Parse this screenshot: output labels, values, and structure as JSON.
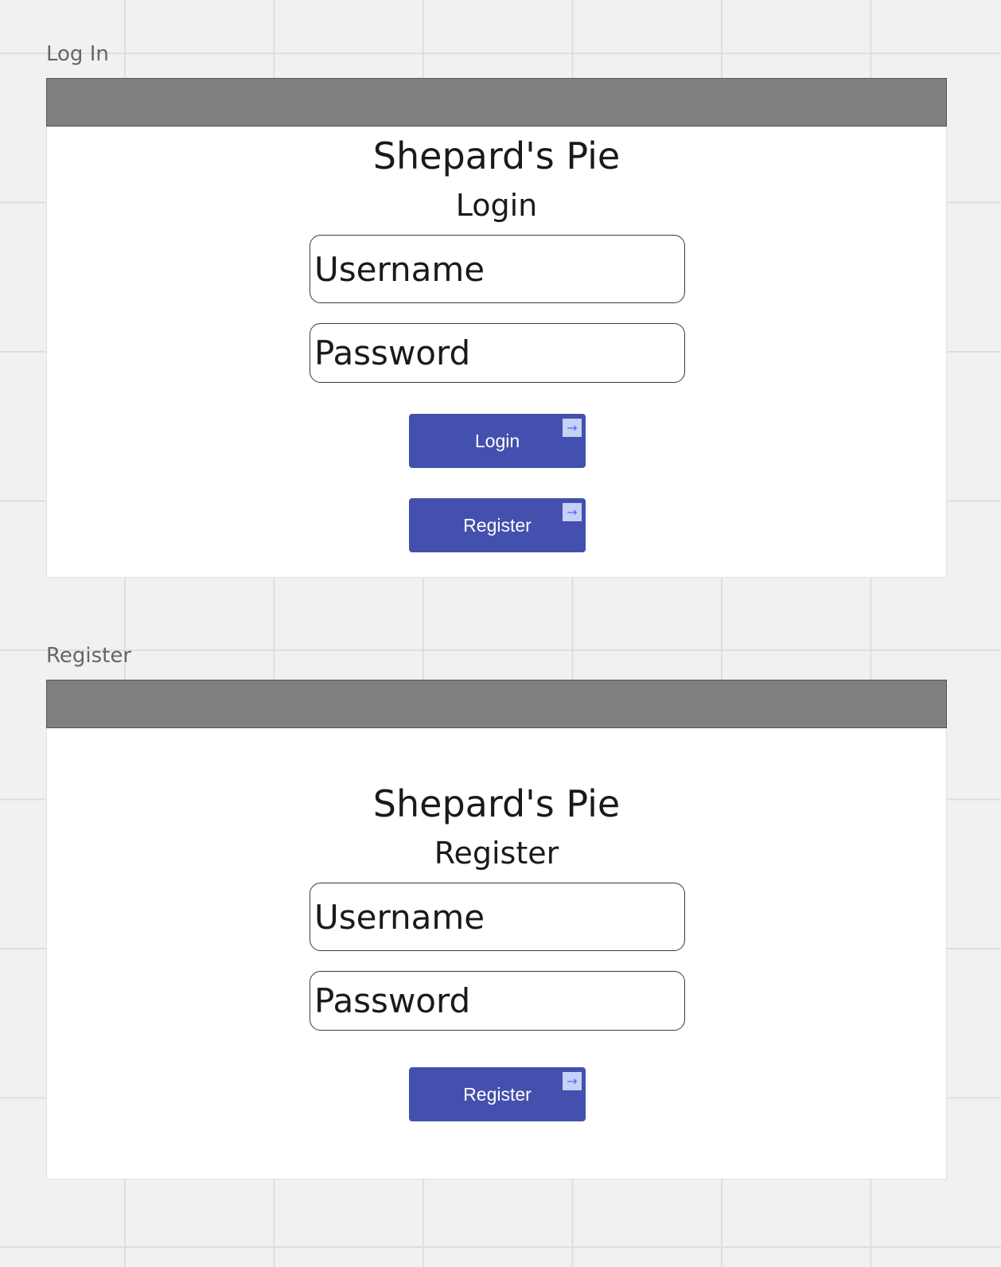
{
  "login_frame": {
    "label": "Log In",
    "app_title": "Shepard's Pie",
    "form_title": "Login",
    "username_placeholder": "Username",
    "password_placeholder": "Password",
    "login_button": "Login",
    "register_button": "Register",
    "button_icon": "arrow-right-icon"
  },
  "register_frame": {
    "label": "Register",
    "app_title": "Shepard's Pie",
    "form_title": "Register",
    "username_placeholder": "Username",
    "password_placeholder": "Password",
    "register_button": "Register",
    "button_icon": "arrow-right-icon"
  },
  "colors": {
    "canvas_background": "#f1f1f1",
    "frame_header": "#808080",
    "button_primary": "#4350ad",
    "button_icon_bg": "#c5d1f7",
    "button_icon_fg": "#4a6cf2"
  }
}
